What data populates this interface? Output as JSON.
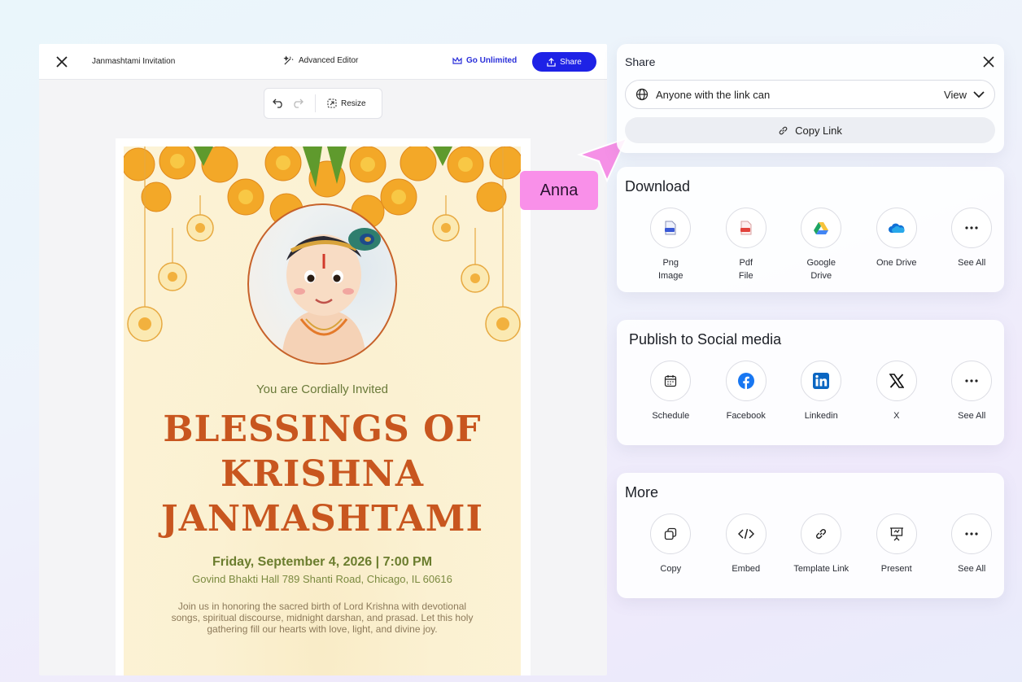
{
  "editor": {
    "doc_title": "Janmashtami Invitation",
    "advanced_editor": "Advanced Editor",
    "go_unlimited": "Go Unlimited",
    "share": "Share",
    "resize": "Resize"
  },
  "card": {
    "invited": "You are Cordially Invited",
    "headline_1": "Blessings of",
    "headline_2": "Krishna",
    "headline_3": "Janmashtami",
    "date": "Friday, September 4, 2026 | 7:00 PM",
    "venue": "Govind Bhakti Hall 789 Shanti Road, Chicago, IL 60616",
    "description": "Join us in honoring the sacred birth of Lord Krishna with devotional songs, spiritual discourse, midnight darshan, and prasad. Let this holy gathering fill our hearts with love, light, and divine joy."
  },
  "share_panel": {
    "title": "Share",
    "access_label": "Anyone with the link can",
    "access_value": "View",
    "copy_link": "Copy Link"
  },
  "download": {
    "title": "Download",
    "items": [
      {
        "label": "Png\nImage",
        "icon": "png-file-icon"
      },
      {
        "label": "Pdf\nFile",
        "icon": "pdf-file-icon"
      },
      {
        "label": "Google\nDrive",
        "icon": "google-drive-icon"
      },
      {
        "label": "One Drive",
        "icon": "onedrive-icon"
      },
      {
        "label": "See All",
        "icon": "more-icon"
      }
    ]
  },
  "social": {
    "title": "Publish to Social media",
    "items": [
      {
        "label": "Schedule",
        "icon": "calendar-icon"
      },
      {
        "label": "Facebook",
        "icon": "facebook-icon"
      },
      {
        "label": "Linkedin",
        "icon": "linkedin-icon"
      },
      {
        "label": "X",
        "icon": "x-icon"
      },
      {
        "label": "See All",
        "icon": "more-icon"
      }
    ]
  },
  "more": {
    "title": "More",
    "items": [
      {
        "label": "Copy",
        "icon": "copy-icon"
      },
      {
        "label": "Embed",
        "icon": "code-icon"
      },
      {
        "label": "Template Link",
        "icon": "link-icon"
      },
      {
        "label": "Present",
        "icon": "present-icon"
      },
      {
        "label": "See All",
        "icon": "more-icon"
      }
    ]
  },
  "cursor": {
    "name": "Anna",
    "color": "#f990e9"
  },
  "colors": {
    "accent": "#1e22e6",
    "headline": "#c8561f",
    "date": "#6b7d2e"
  }
}
